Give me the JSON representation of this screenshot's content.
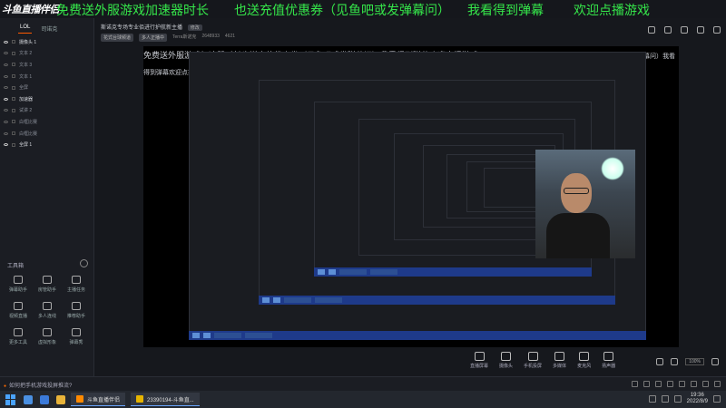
{
  "banner": {
    "logo": "斗鱼直播伴侣",
    "viewer_count": "2648933",
    "segments": [
      "免费送外服游戏加速器时长",
      "也送充值优惠券（见鱼吧或发弹幕问）",
      "我看得到弹幕",
      "欢迎点播游戏"
    ],
    "color": "#35e64a"
  },
  "left_panel": {
    "tabs": [
      "LOL",
      "司诺克"
    ],
    "scenes": [
      {
        "label": "摄像头 1",
        "visible": true
      },
      {
        "label": "文本 2",
        "visible": false
      },
      {
        "label": "文本 3",
        "visible": false
      },
      {
        "label": "文本 1",
        "visible": false
      },
      {
        "label": "全屏",
        "visible": false
      },
      {
        "label": "加速器",
        "visible": true
      },
      {
        "label": "试讲 2",
        "visible": false
      },
      {
        "label": "白框比赛",
        "visible": false
      },
      {
        "label": "白框比赛",
        "visible": false
      },
      {
        "label": "全屏 1",
        "visible": true
      }
    ],
    "tools_title": "工具箱",
    "tools": [
      {
        "label": "弹幕助手",
        "icon": "danmu-icon"
      },
      {
        "label": "房管助手",
        "icon": "admin-icon"
      },
      {
        "label": "主播任务",
        "icon": "task-icon"
      },
      {
        "label": "视频直播",
        "icon": "video-icon"
      },
      {
        "label": "多人连线",
        "icon": "link-icon"
      },
      {
        "label": "推荐助手",
        "icon": "recommend-icon"
      },
      {
        "label": "更多工具",
        "icon": "more-icon"
      },
      {
        "label": "虚拟形象",
        "icon": "avatar-icon"
      },
      {
        "label": "弹幕秀",
        "icon": "show-icon"
      }
    ]
  },
  "main": {
    "room_title": "斯诺克专场专业佰进行护航新主播",
    "edit_label": "修改",
    "meta": [
      "花式台球频道",
      "多人正播中",
      "Terra斯诺克",
      "2648933",
      "4621"
    ],
    "bottom_tools": [
      "直播屏幕",
      "摄像头",
      "手机投屏",
      "多媒体",
      "麦克风",
      "扬声器"
    ],
    "zoom": "100%"
  },
  "status": {
    "notice": "如何把手机游戏投屏推流?"
  },
  "taskbar": {
    "apps": [
      "斗鱼直播伴侣",
      "23390194-斗鱼直..."
    ],
    "time": "19:36",
    "date": "2022/8/9"
  }
}
